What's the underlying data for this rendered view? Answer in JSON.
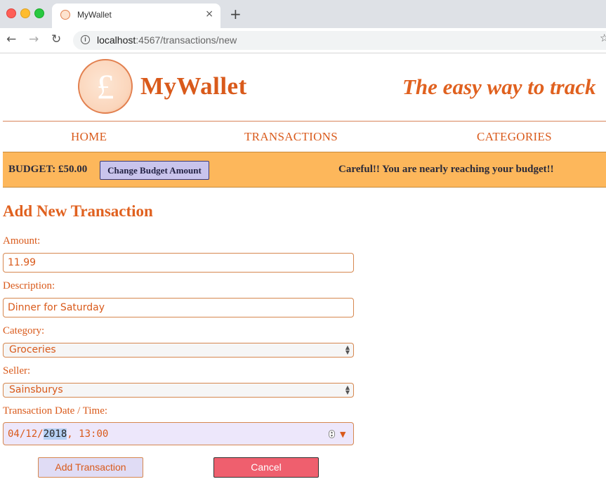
{
  "browser": {
    "tab_title": "MyWallet",
    "tab_close": "×",
    "new_tab": "+",
    "back": "←",
    "forward": "→",
    "reload": "↻",
    "info_icon": "i",
    "url_host": "localhost",
    "url_path": ":4567/transactions/new",
    "bookmark": "☆"
  },
  "header": {
    "logo_symbol": "£",
    "brand": "MyWallet",
    "tagline": "The easy way to track"
  },
  "nav": {
    "items": [
      {
        "label": "HOME"
      },
      {
        "label": "TRANSACTIONS"
      },
      {
        "label": "CATEGORIES"
      }
    ]
  },
  "budget": {
    "label": "BUDGET: £50.00",
    "change_button": "Change Budget Amount",
    "warning": "Careful!! You are nearly reaching your budget!!"
  },
  "form": {
    "title": "Add New Transaction",
    "amount_label": "Amount:",
    "amount_value": "11.99",
    "description_label": "Description:",
    "description_value": "Dinner for Saturday",
    "category_label": "Category:",
    "category_value": "Groceries",
    "seller_label": "Seller:",
    "seller_value": "Sainsburys",
    "datetime_label": "Transaction Date / Time:",
    "date_day_month": "04/12/",
    "date_year": "2018",
    "time_value": ", 13:00",
    "add_button": "Add Transaction",
    "cancel_button": "Cancel"
  },
  "colors": {
    "accent": "#d95a1b",
    "budget_bar": "#fdb75b",
    "cancel": "#ef5f6e",
    "button_lavender": "#c9c4ec"
  }
}
